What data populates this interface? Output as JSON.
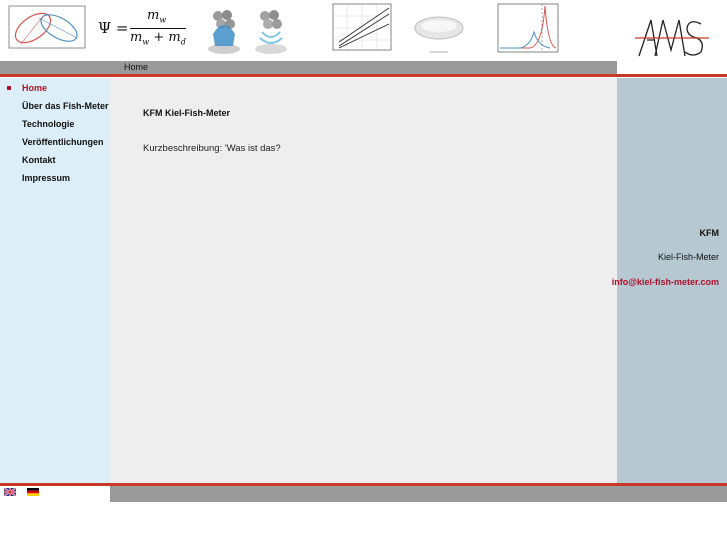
{
  "breadcrumb": {
    "label": "Home"
  },
  "header_formula": {
    "lhs": "Ψ =",
    "numerator": "m",
    "numerator_sub": "w",
    "denominator": "m",
    "denominator_sub1": "w",
    "denominator_plus": "+ m",
    "denominator_sub2": "d"
  },
  "sidebar": {
    "items": [
      {
        "label": "Home",
        "active": true
      },
      {
        "label": "Über das Fish-Meter",
        "active": false
      },
      {
        "label": "Technologie",
        "active": false
      },
      {
        "label": "Veröffentlichungen",
        "active": false
      },
      {
        "label": "Kontakt",
        "active": false
      },
      {
        "label": "Impressum",
        "active": false
      }
    ]
  },
  "main": {
    "title": "KFM Kiel-Fish-Meter",
    "description": "Kurzbeschreibung: 'Was ist das?"
  },
  "right_panel": {
    "abbr": "KFM",
    "name": "Kiel-Fish-Meter",
    "email": "info@kiel-fish-meter.com"
  },
  "colors": {
    "accent_red": "#c8392a",
    "link_red": "#b0102a",
    "sidebar_bg": "#dceef7",
    "main_bg": "#eeeeee",
    "right_bg": "#b6c9d2",
    "bar_gray": "#9a9a9a"
  },
  "languages": [
    "english-flag-icon",
    "german-flag-icon"
  ]
}
